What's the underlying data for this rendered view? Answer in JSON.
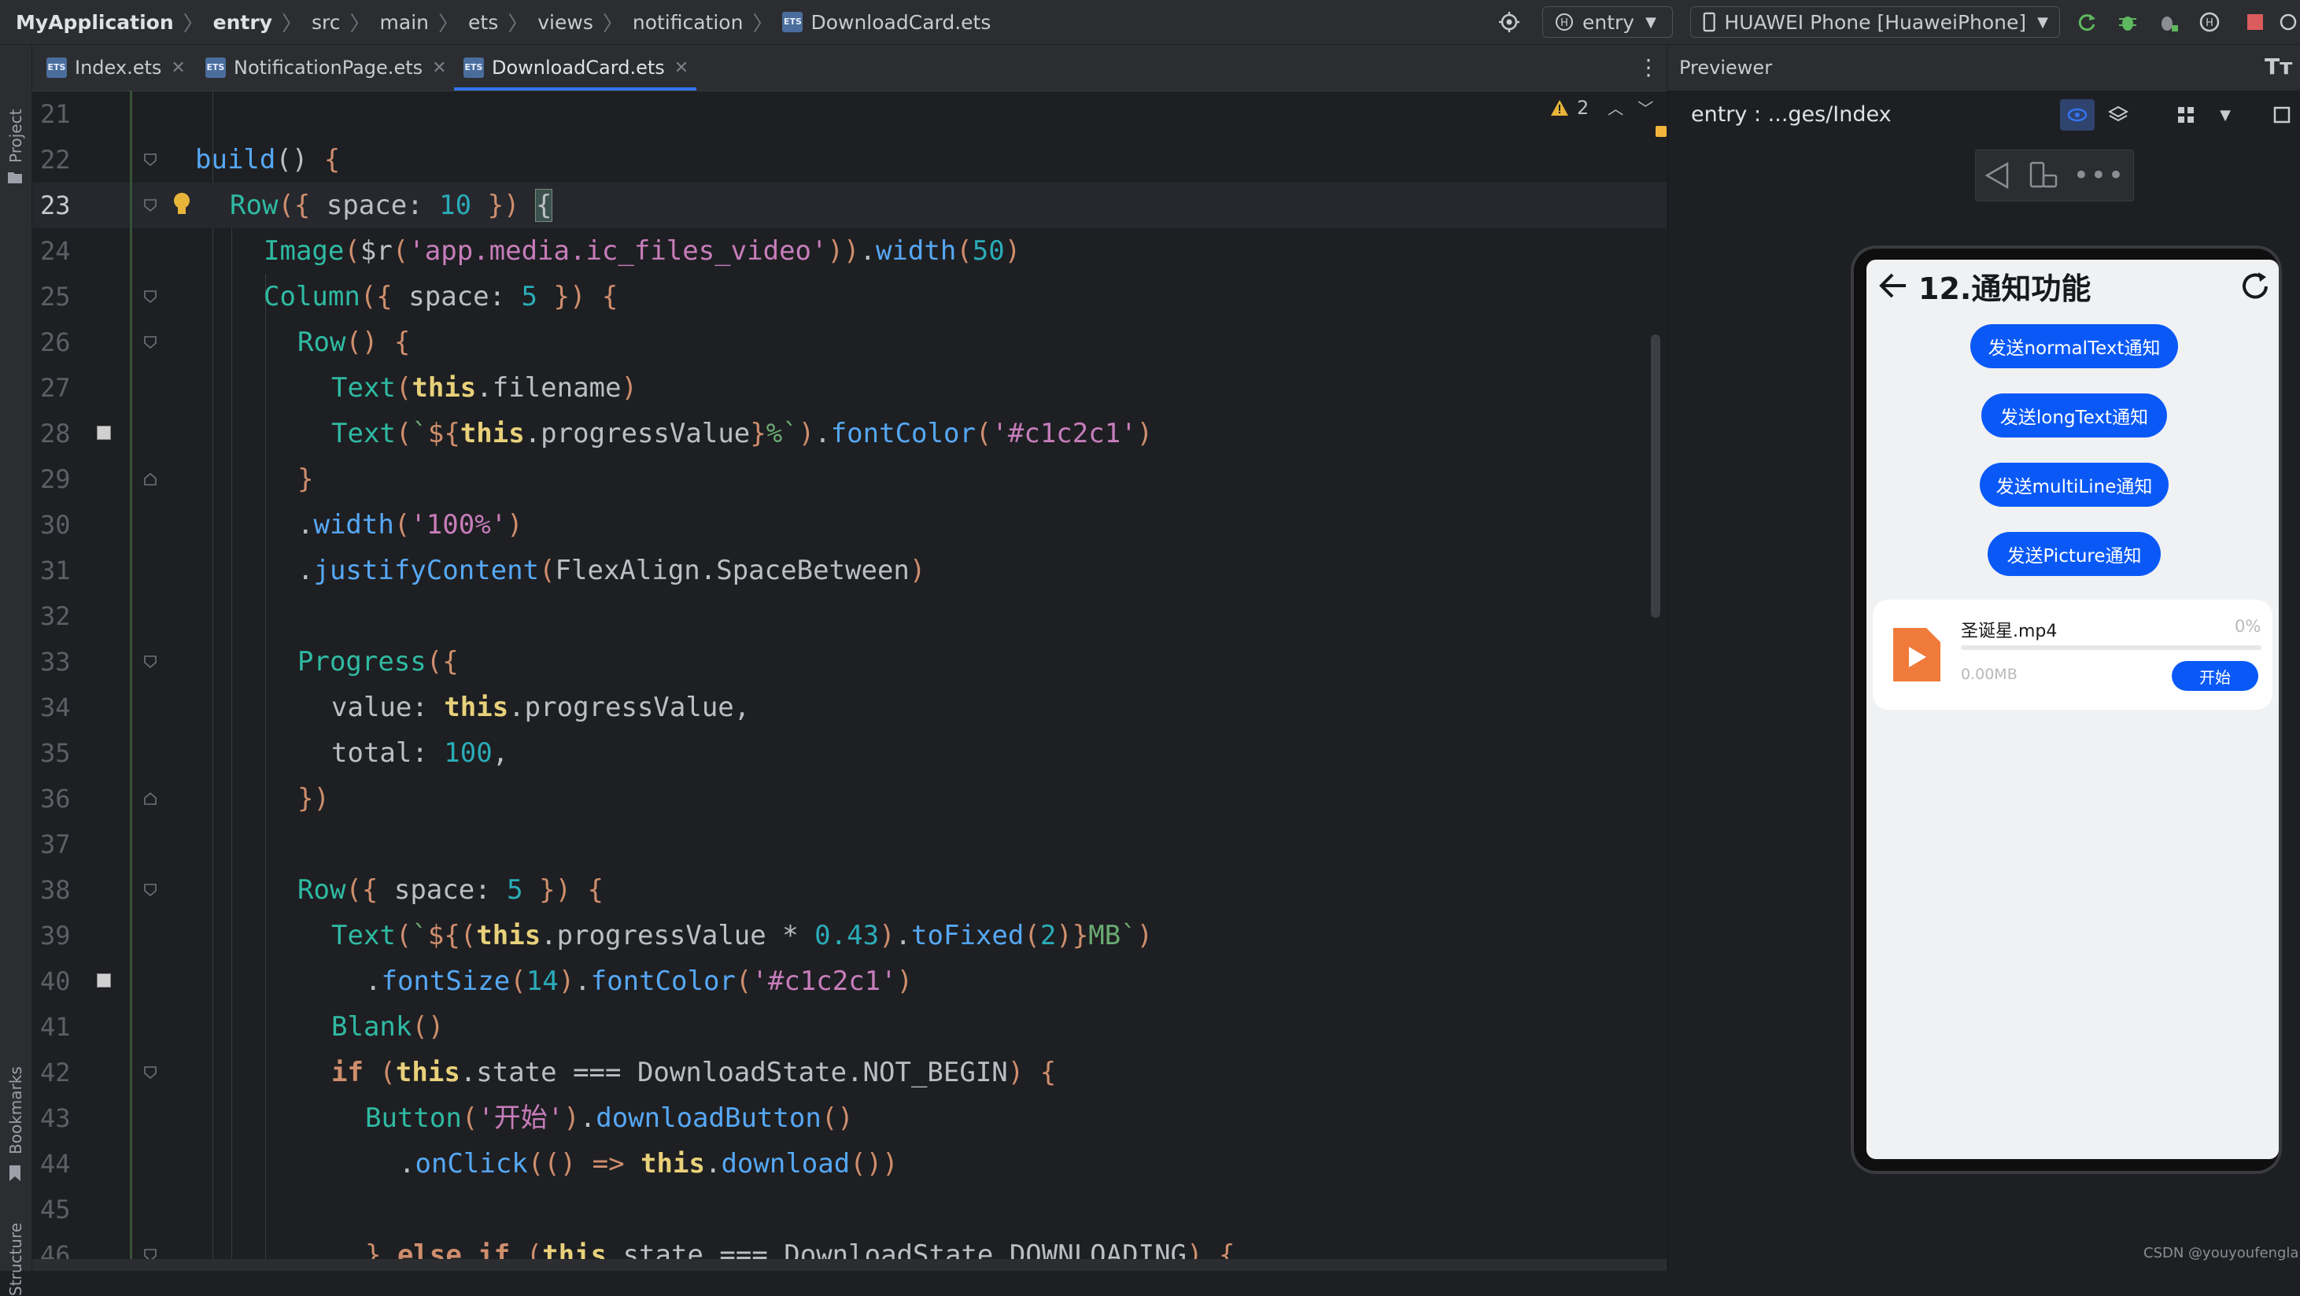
{
  "navbar": {
    "breadcrumbs": [
      "MyApplication",
      "entry",
      "src",
      "main",
      "ets",
      "views",
      "notification",
      "DownloadCard.ets"
    ],
    "run_config": "entry",
    "device": "HUAWEI Phone [HuaweiPhone]"
  },
  "left_tools": {
    "project": "Project",
    "bookmarks": "Bookmarks",
    "structure": "Structure"
  },
  "tabs": [
    {
      "label": "Index.ets",
      "active": false
    },
    {
      "label": "NotificationPage.ets",
      "active": false
    },
    {
      "label": "DownloadCard.ets",
      "active": true
    }
  ],
  "editor": {
    "warnings_count": "2",
    "lines": [
      {
        "n": "21",
        "text": ""
      },
      {
        "n": "22",
        "text": "build() {"
      },
      {
        "n": "23",
        "text": "Row({ space: 10 }) {"
      },
      {
        "n": "24",
        "text": "Image($r('app.media.ic_files_video')).width(50)"
      },
      {
        "n": "25",
        "text": "Column({ space: 5 }) {"
      },
      {
        "n": "26",
        "text": "Row() {"
      },
      {
        "n": "27",
        "text": "Text(this.filename)"
      },
      {
        "n": "28",
        "text": "Text(`${this.progressValue}%`).fontColor('#c1c2c1')"
      },
      {
        "n": "29",
        "text": "}"
      },
      {
        "n": "30",
        "text": ".width('100%')"
      },
      {
        "n": "31",
        "text": ".justifyContent(FlexAlign.SpaceBetween)"
      },
      {
        "n": "32",
        "text": ""
      },
      {
        "n": "33",
        "text": "Progress({"
      },
      {
        "n": "34",
        "text": "value: this.progressValue,"
      },
      {
        "n": "35",
        "text": "total: 100,"
      },
      {
        "n": "36",
        "text": "})"
      },
      {
        "n": "37",
        "text": ""
      },
      {
        "n": "38",
        "text": "Row({ space: 5 }) {"
      },
      {
        "n": "39",
        "text": "Text(`${(this.progressValue * 0.43).toFixed(2)}MB`)"
      },
      {
        "n": "40",
        "text": ".fontSize(14).fontColor('#c1c2c1')"
      },
      {
        "n": "41",
        "text": "Blank()"
      },
      {
        "n": "42",
        "text": "if (this.state === DownloadState.NOT_BEGIN) {"
      },
      {
        "n": "43",
        "text": "Button('开始').downloadButton()"
      },
      {
        "n": "44",
        "text": ".onClick(() => this.download())"
      },
      {
        "n": "45",
        "text": ""
      },
      {
        "n": "46",
        "text": "} else if (this.state === DownloadState.DOWNLOADING) {"
      }
    ]
  },
  "previewer": {
    "title": "Previewer",
    "page": "entry : ...ges/Index",
    "app_title": "12.通知功能",
    "buttons": [
      "发送normalText通知",
      "发送longText通知",
      "发送multiLine通知",
      "发送Picture通知"
    ],
    "download_card": {
      "filename": "圣诞星.mp4",
      "percent": "0%",
      "size": "0.00MB",
      "progress": 0,
      "button": "开始"
    }
  },
  "watermark": "CSDN @youyoufengla",
  "colors": {
    "accent": "#3574f0",
    "phone_button": "#0a59f7",
    "file_icon": "#f07a3a"
  }
}
